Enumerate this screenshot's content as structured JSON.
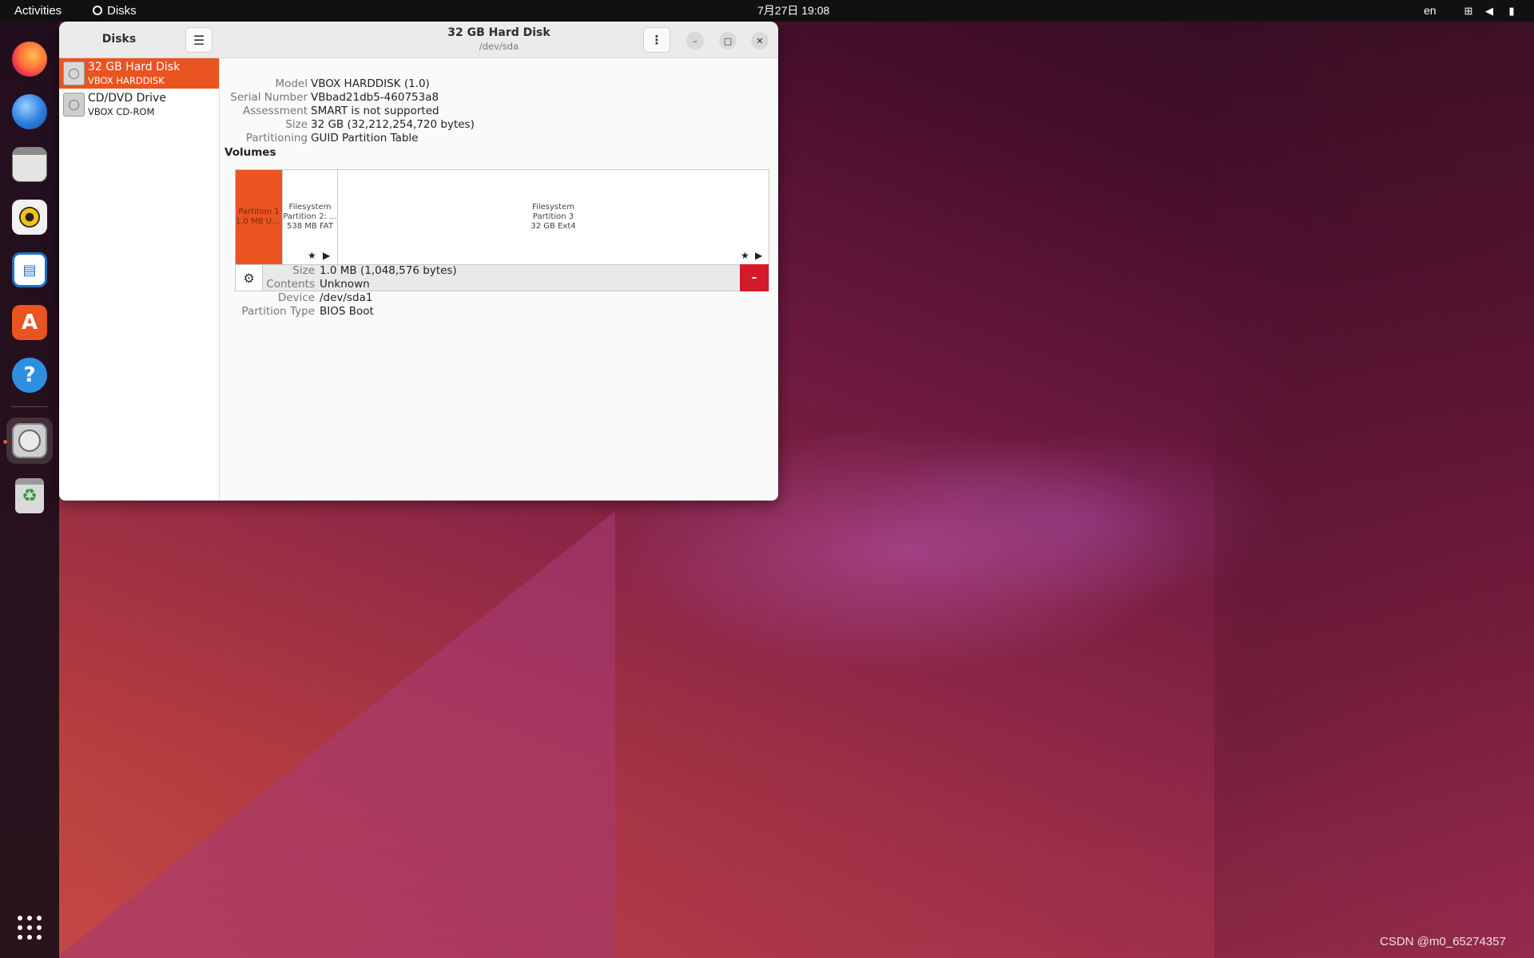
{
  "topbar": {
    "activities": "Activities",
    "app_name": "Disks",
    "clock": "7月27日  19:08",
    "language": "en"
  },
  "dock": {
    "items": [
      "firefox-icon",
      "thunderbird-icon",
      "files-icon",
      "rhythmbox-icon",
      "libreoffice-writer-icon",
      "software-icon",
      "help-icon",
      "disks-icon",
      "trash-icon",
      "show-apps-icon"
    ],
    "writer_glyph": "▤",
    "software_glyph": "A",
    "help_glyph": "?",
    "trash_glyph": "♻"
  },
  "window": {
    "sidebar_title": "Disks",
    "menu_glyph": "☰",
    "title": "32 GB Hard Disk",
    "subtitle": "/dev/sda",
    "kebab_glyph": "⋮",
    "minimize_glyph": "–",
    "maximize_glyph": "□",
    "close_glyph": "✕"
  },
  "disks": [
    {
      "name": "32 GB Hard Disk",
      "sub": "VBOX HARDDISK",
      "selected": true
    },
    {
      "name": "CD/DVD Drive",
      "sub": "VBOX CD-ROM",
      "selected": false
    }
  ],
  "drive_info": {
    "model_label": "Model",
    "model": "VBOX HARDDISK (1.0)",
    "serial_label": "Serial Number",
    "serial": "VBbad21db5-460753a8",
    "assessment_label": "Assessment",
    "assessment": "SMART is not supported",
    "size_label": "Size",
    "size": "32 GB (32,212,254,720 bytes)",
    "partitioning_label": "Partitioning",
    "partitioning": "GUID Partition Table"
  },
  "volumes": {
    "label": "Volumes",
    "partitions": [
      {
        "line1": "Partition 1",
        "line2": "1.0 MB Un...",
        "selected": true
      },
      {
        "line1": "Filesystem",
        "line2": "Partition 2: ...",
        "line3": "538 MB FAT"
      },
      {
        "line1": "Filesystem",
        "line2": "Partition 3",
        "line3": "32 GB Ext4"
      }
    ],
    "star_glyph": "★",
    "play_glyph": "▶",
    "gear_glyph": "⚙",
    "delete_glyph": "–"
  },
  "partition_info": {
    "size_label": "Size",
    "size": "1.0 MB (1,048,576 bytes)",
    "contents_label": "Contents",
    "contents": "Unknown",
    "device_label": "Device",
    "device": "/dev/sda1",
    "type_label": "Partition Type",
    "type": "BIOS Boot"
  },
  "watermark": "CSDN @m0_65274357",
  "colors": {
    "accent": "#e95420",
    "danger": "#d51a2a",
    "topbar": "#111111"
  }
}
